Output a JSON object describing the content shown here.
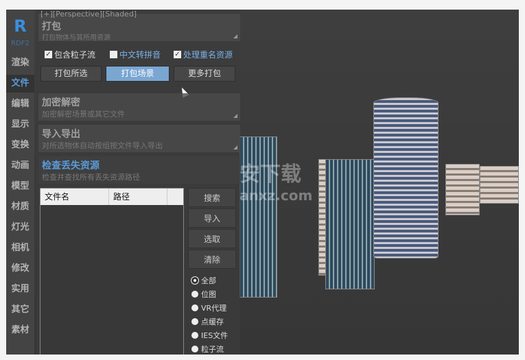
{
  "viewport": {
    "label": "[+][Perspective][Shaded]",
    "watermark": "安下载",
    "watermark_sub": "anxz.com"
  },
  "nav": {
    "logo": "R",
    "logo_sub": "RDF2",
    "items": [
      {
        "label": "渲染"
      },
      {
        "label": "文件",
        "active": true
      },
      {
        "label": "编辑"
      },
      {
        "label": "显示"
      },
      {
        "label": "变换"
      },
      {
        "label": "动画"
      },
      {
        "label": "模型"
      },
      {
        "label": "材质"
      },
      {
        "label": "灯光"
      },
      {
        "label": "相机"
      },
      {
        "label": "修改"
      },
      {
        "label": "实用"
      },
      {
        "label": "其它"
      },
      {
        "label": "素材"
      }
    ]
  },
  "pack": {
    "title": "打包",
    "subtitle": "打包物体与其所用资源",
    "options": [
      {
        "label": "包含粒子流",
        "checked": true
      },
      {
        "label": "中文转拼音",
        "checked": false
      },
      {
        "label": "处理重名资源",
        "checked": true
      }
    ],
    "buttons": [
      "打包所选",
      "打包场景",
      "更多打包"
    ]
  },
  "encrypt": {
    "title": "加密解密",
    "subtitle": "加密解密场景或其它文件"
  },
  "io": {
    "title": "导入导出",
    "subtitle": "对所选物体自动按组按文件导入导出"
  },
  "missing": {
    "title": "检查丢失资源",
    "subtitle": "检查并查找所有丢失资源路径",
    "columns": [
      "文件名",
      "路径"
    ],
    "buttons": [
      "搜索",
      "导入",
      "选取",
      "清除"
    ],
    "filters": [
      {
        "label": "全部",
        "selected": true
      },
      {
        "label": "位图"
      },
      {
        "label": "VR代理"
      },
      {
        "label": "点缓存"
      },
      {
        "label": "IES文件"
      },
      {
        "label": "粒子流"
      }
    ]
  },
  "colors": {
    "accent": "#5a9ad8",
    "primary_button": "#7aa6d2"
  }
}
